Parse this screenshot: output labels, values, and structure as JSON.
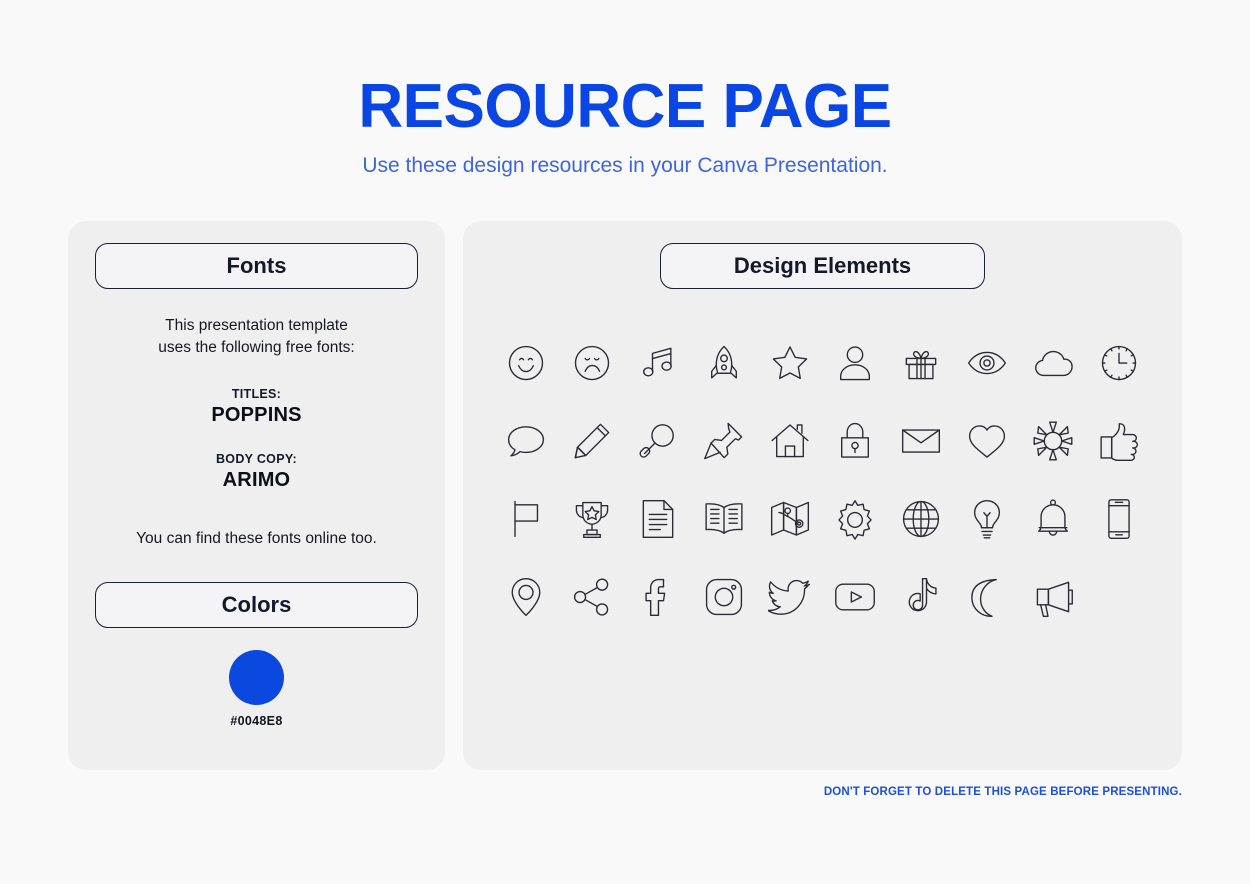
{
  "header": {
    "title": "RESOURCE PAGE",
    "subtitle": "Use these design resources in your Canva Presentation."
  },
  "fonts_panel": {
    "heading": "Fonts",
    "intro_line1": "This presentation template",
    "intro_line2": "uses the following free fonts:",
    "titles_label": "TITLES:",
    "titles_font": "POPPINS",
    "body_label": "BODY COPY:",
    "body_font": "ARIMO",
    "footnote": "You can find these fonts online too."
  },
  "colors_panel": {
    "heading": "Colors",
    "swatch_hex": "#0048E8",
    "swatch_color": "#0b48e0"
  },
  "design_panel": {
    "heading": "Design Elements",
    "icons": [
      "smiley-face-icon",
      "sad-face-icon",
      "music-note-icon",
      "rocket-icon",
      "star-icon",
      "person-icon",
      "gift-icon",
      "eye-icon",
      "cloud-icon",
      "clock-icon",
      "speech-bubble-icon",
      "pencil-icon",
      "magnifying-glass-icon",
      "pushpin-icon",
      "house-icon",
      "padlock-icon",
      "envelope-icon",
      "heart-icon",
      "sun-icon",
      "thumbs-up-icon",
      "flag-icon",
      "trophy-icon",
      "document-icon",
      "open-book-icon",
      "map-icon",
      "gear-icon",
      "globe-icon",
      "lightbulb-icon",
      "bell-icon",
      "mobile-phone-icon",
      "location-pin-icon",
      "share-icon",
      "facebook-icon",
      "instagram-icon",
      "twitter-icon",
      "youtube-icon",
      "tiktok-icon",
      "moon-icon",
      "megaphone-icon"
    ]
  },
  "footer": {
    "note": "DON'T FORGET TO DELETE THIS PAGE BEFORE PRESENTING."
  },
  "theme": {
    "page_background": "#f9f9f9",
    "panel_background": "#efefef",
    "brand_blue": "#0a46e4",
    "subtitle_blue": "#3d66dd",
    "footer_blue": "#1d4fd8",
    "outline_dark": "#1b1f33",
    "icon_stroke": "#2b2b33"
  }
}
